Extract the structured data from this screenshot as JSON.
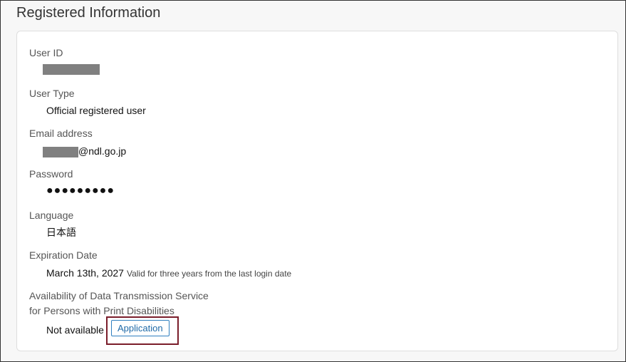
{
  "section": {
    "title": "Registered Information"
  },
  "fields": {
    "user_id": {
      "label": "User ID"
    },
    "user_type": {
      "label": "User Type",
      "value": "Official registered user"
    },
    "email": {
      "label": "Email address",
      "domain": "@ndl.go.jp"
    },
    "password": {
      "label": "Password",
      "value": "●●●●●●●●●"
    },
    "language": {
      "label": "Language",
      "value": "日本語"
    },
    "expiration": {
      "label": "Expiration Date",
      "value": "March 13th, 2027",
      "note": "Valid for three years from the last login date"
    },
    "availability": {
      "label_line1": "Availability of Data Transmission Service",
      "label_line2": "for Persons with Print Disabilities",
      "value": "Not available",
      "button_label": "Application"
    }
  },
  "colors": {
    "highlight_border": "#7a1d2a",
    "button_border": "#2f7fbf",
    "redaction": "#808080"
  }
}
